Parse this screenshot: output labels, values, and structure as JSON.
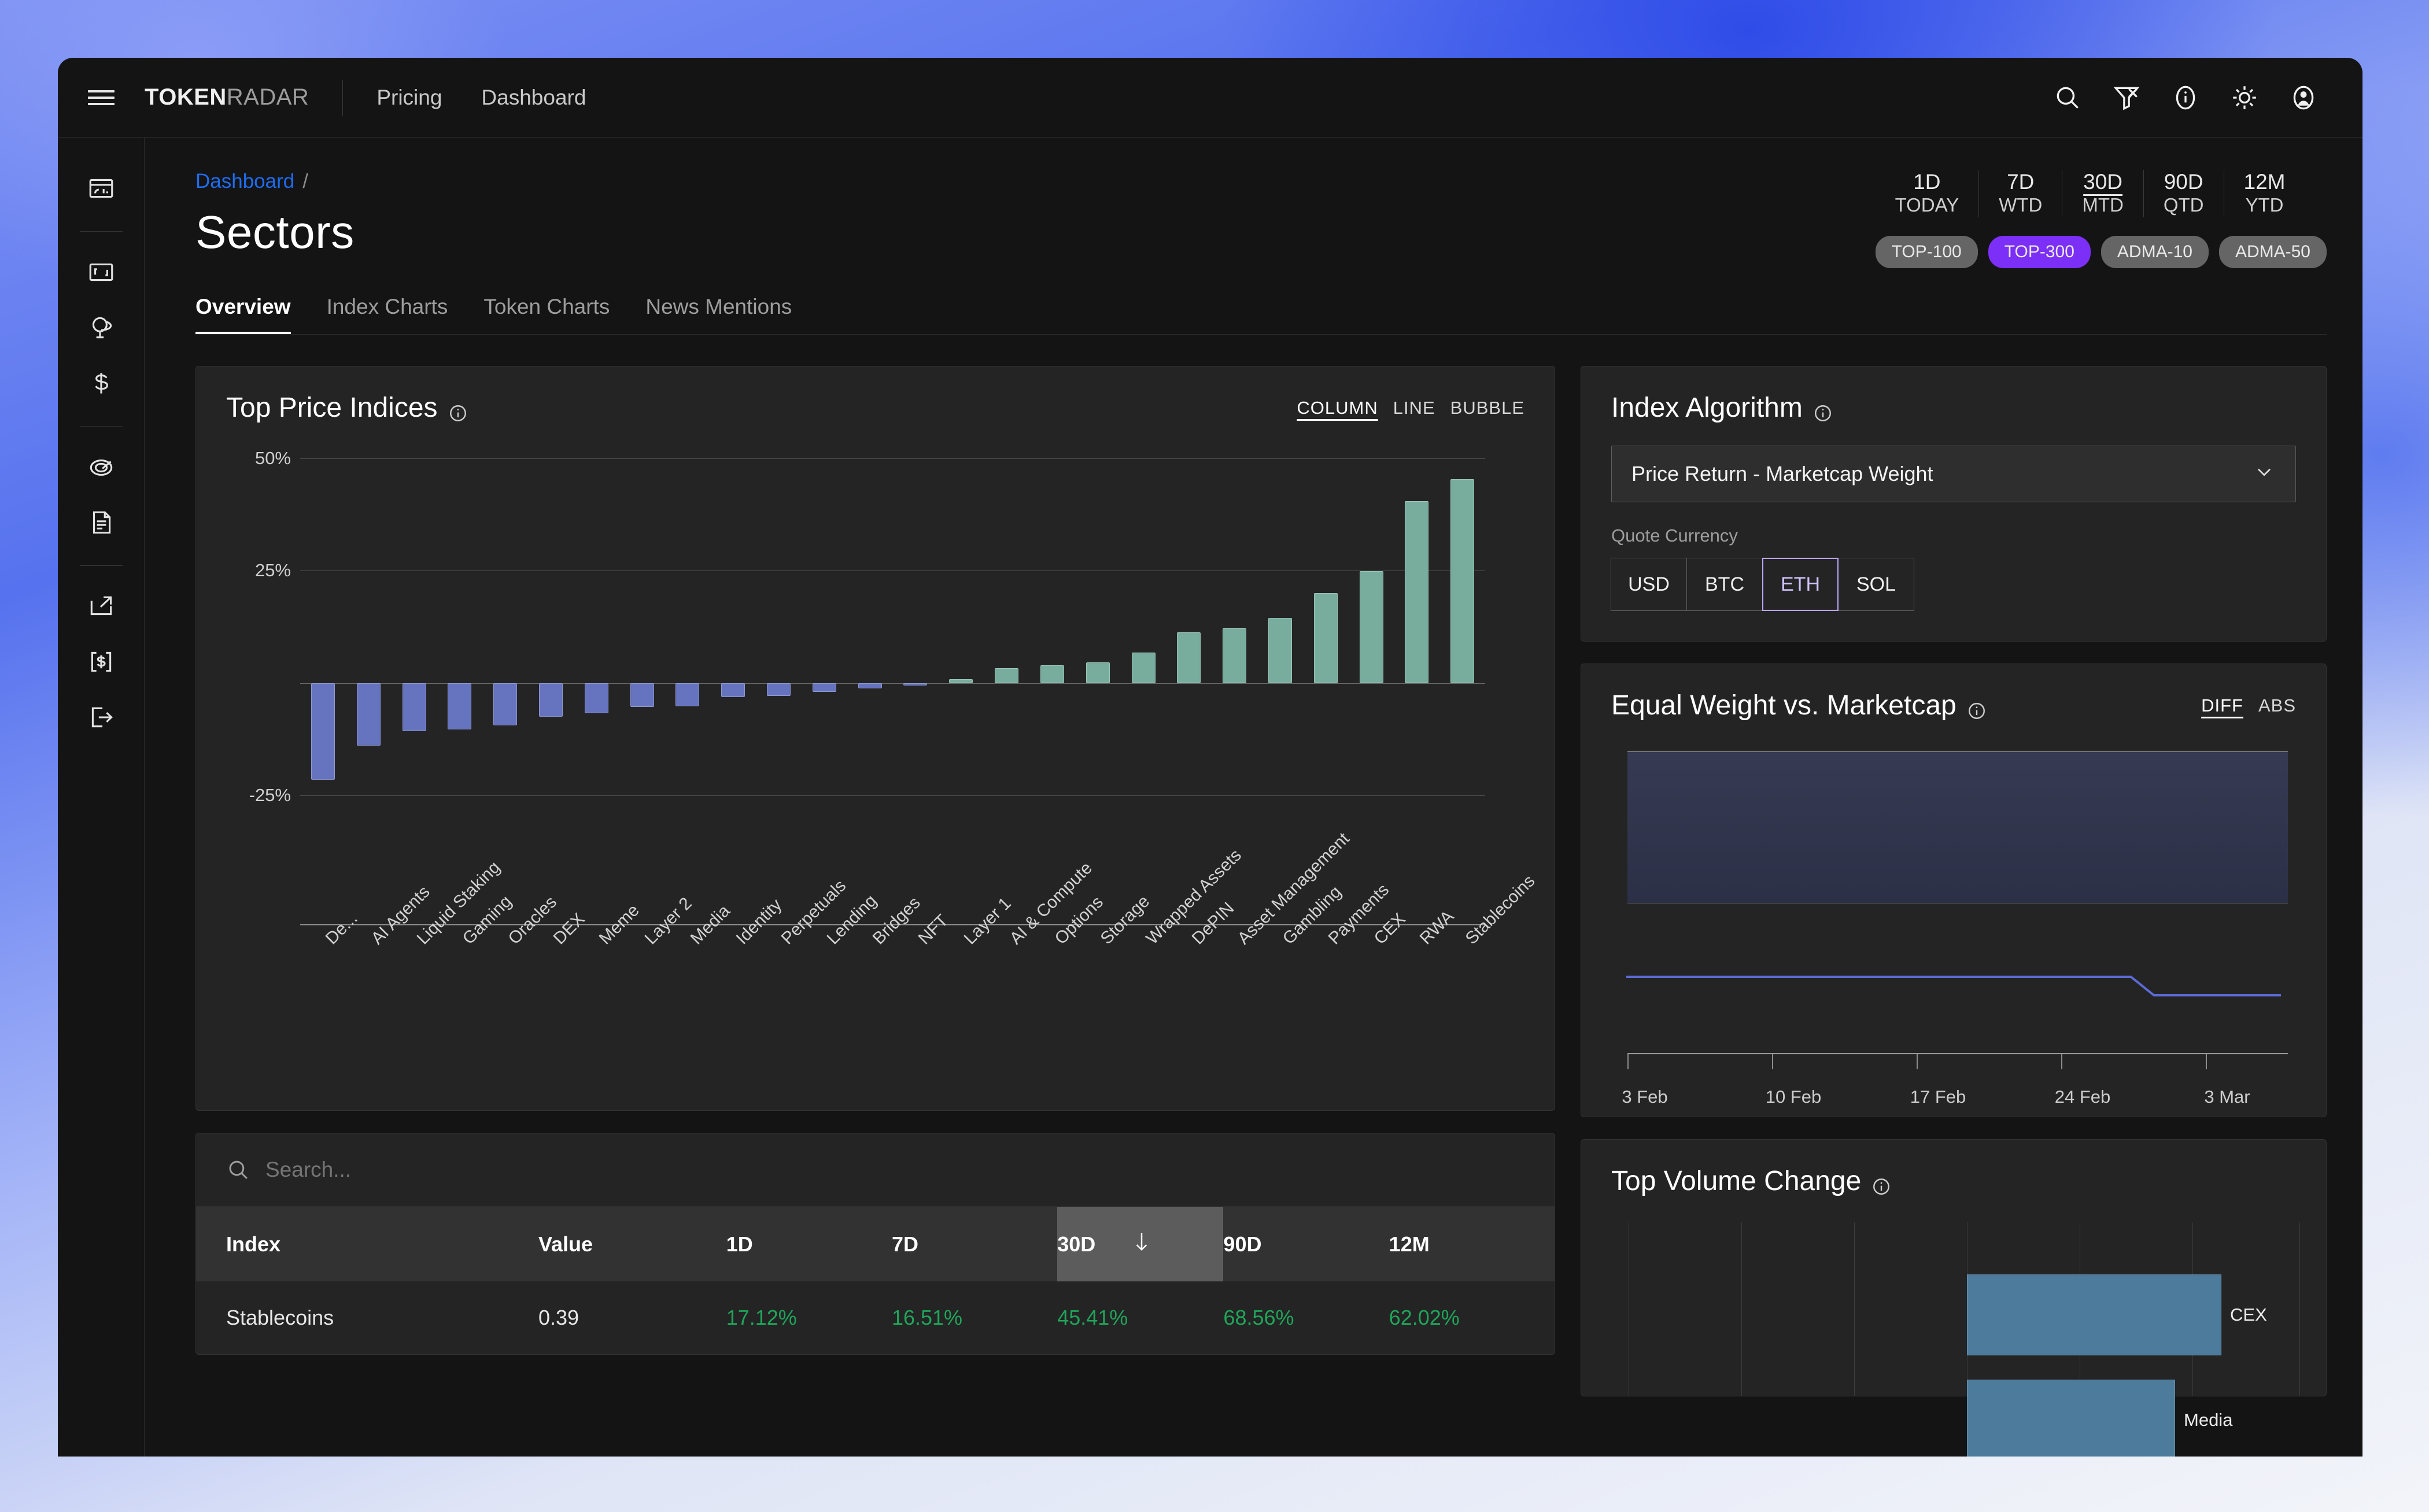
{
  "brand": {
    "bold": "TOKEN",
    "light": "RADAR"
  },
  "topnav": {
    "links": [
      "Pricing",
      "Dashboard"
    ]
  },
  "topicons": [
    "search-icon",
    "filter-remove-icon",
    "info-icon",
    "brightness-icon",
    "account-icon"
  ],
  "rail": [
    "dashboard-layout-icon",
    "expand-icon",
    "globe-radar-icon",
    "dollar-icon",
    "target-icon",
    "document-icon",
    "external-link-icon",
    "bracket-dollar-icon",
    "logout-icon"
  ],
  "breadcrumb": {
    "root": "Dashboard",
    "separator": "/"
  },
  "page_title": "Sectors",
  "tabs": [
    {
      "label": "Overview",
      "active": true
    },
    {
      "label": "Index Charts",
      "active": false
    },
    {
      "label": "Token Charts",
      "active": false
    },
    {
      "label": "News Mentions",
      "active": false
    }
  ],
  "periods": [
    {
      "top": "1D",
      "bottom": "TODAY",
      "active": false
    },
    {
      "top": "7D",
      "bottom": "WTD",
      "active": false
    },
    {
      "top": "30D",
      "bottom": "MTD",
      "active": true
    },
    {
      "top": "90D",
      "bottom": "QTD",
      "active": false
    },
    {
      "top": "12M",
      "bottom": "YTD",
      "active": false
    }
  ],
  "chips": [
    {
      "label": "TOP-100",
      "selected": false
    },
    {
      "label": "TOP-300",
      "selected": true
    },
    {
      "label": "ADMA-10",
      "selected": false
    },
    {
      "label": "ADMA-50",
      "selected": false
    }
  ],
  "accent_purple": "#7b2ff7",
  "accent_blue": "#1e6cf0",
  "top_price_indices": {
    "title": "Top Price Indices",
    "view_modes": [
      {
        "label": "COLUMN",
        "active": true
      },
      {
        "label": "LINE",
        "active": false
      },
      {
        "label": "BUBBLE",
        "active": false
      }
    ]
  },
  "index_algorithm": {
    "title": "Index Algorithm",
    "selected_algorithm": "Price Return - Marketcap Weight",
    "quote_currency_label": "Quote Currency",
    "quote_currencies": [
      {
        "label": "USD",
        "selected": false
      },
      {
        "label": "BTC",
        "selected": false
      },
      {
        "label": "ETH",
        "selected": true
      },
      {
        "label": "SOL",
        "selected": false
      }
    ]
  },
  "equal_weight": {
    "title": "Equal Weight vs. Marketcap",
    "modes": [
      {
        "label": "DIFF",
        "active": true
      },
      {
        "label": "ABS",
        "active": false
      }
    ]
  },
  "top_volume_change": {
    "title": "Top Volume Change"
  },
  "table": {
    "search_placeholder": "Search...",
    "search_value": "",
    "sort_column": "30D",
    "sort_direction": "desc",
    "columns": [
      "Index",
      "Value",
      "1D",
      "7D",
      "30D",
      "90D",
      "12M"
    ],
    "rows": [
      {
        "index": "Stablecoins",
        "value": "0.39",
        "d1": "17.12%",
        "d7": "16.51%",
        "d30": "45.41%",
        "d90": "68.56%",
        "m12": "62.02%"
      }
    ]
  },
  "chart_data": [
    {
      "id": "top-price-indices",
      "type": "bar",
      "title": "Top Price Indices",
      "xlabel": "",
      "ylabel": "",
      "ylim": [
        -40,
        50
      ],
      "yticks": [
        "50%",
        "25%",
        "-25%"
      ],
      "grid": true,
      "legend": "none",
      "unit": "%",
      "categories": [
        "De...",
        "AI Agents",
        "Liquid Staking",
        "Gaming",
        "Oracles",
        "DEX",
        "Meme",
        "Layer 2",
        "Media",
        "Identity",
        "Perpetuals",
        "Lending",
        "Bridges",
        "NFT",
        "Layer 1",
        "AI & Compute",
        "Options",
        "Storage",
        "Wrapped Assets",
        "DePIN",
        "Asset Management",
        "Gambling",
        "Payments",
        "CEX",
        "RWA",
        "Stablecoins"
      ],
      "values": [
        -21.5,
        -13.8,
        -10.6,
        -10.2,
        -9.3,
        -7.4,
        -6.6,
        -5.2,
        -5.1,
        -3.0,
        -2.8,
        -1.9,
        -1.1,
        -0.4,
        0.9,
        3.4,
        4.0,
        4.6,
        6.8,
        11.3,
        12.3,
        14.5,
        20.1,
        25.0,
        40.5,
        45.4
      ],
      "positive_color": "#78ad9e",
      "negative_color": "#6673be"
    },
    {
      "id": "equal-weight-vs-marketcap",
      "type": "line",
      "title": "Equal Weight vs. Marketcap",
      "mode": "DIFF",
      "xlabel": "",
      "ylabel": "",
      "grid": true,
      "legend": "none",
      "xticks": [
        "3 Feb",
        "10 Feb",
        "17 Feb",
        "24 Feb",
        "3 Mar"
      ],
      "x": [
        "3 Feb",
        "10 Feb",
        "17 Feb",
        "24 Feb",
        "3 Mar"
      ],
      "values": [
        0.0,
        0.0,
        0.0,
        0.0,
        -1.0
      ],
      "series": [
        {
          "name": "diff",
          "color": "#5b6bd6",
          "values": [
            0,
            0,
            0,
            0,
            0,
            0,
            0,
            0,
            0,
            0,
            0,
            0,
            0,
            0,
            0,
            0,
            0,
            0,
            0,
            0,
            0,
            0,
            0,
            -1,
            -1,
            -1,
            -1,
            -1
          ]
        }
      ]
    },
    {
      "id": "top-volume-change",
      "type": "bar",
      "orientation": "horizontal",
      "title": "Top Volume Change",
      "xlabel": "",
      "ylabel": "",
      "grid": true,
      "legend": "none",
      "categories": [
        "CEX",
        "Media"
      ],
      "values": [
        78,
        68
      ],
      "bar_color": "#4d7b9c"
    }
  ]
}
